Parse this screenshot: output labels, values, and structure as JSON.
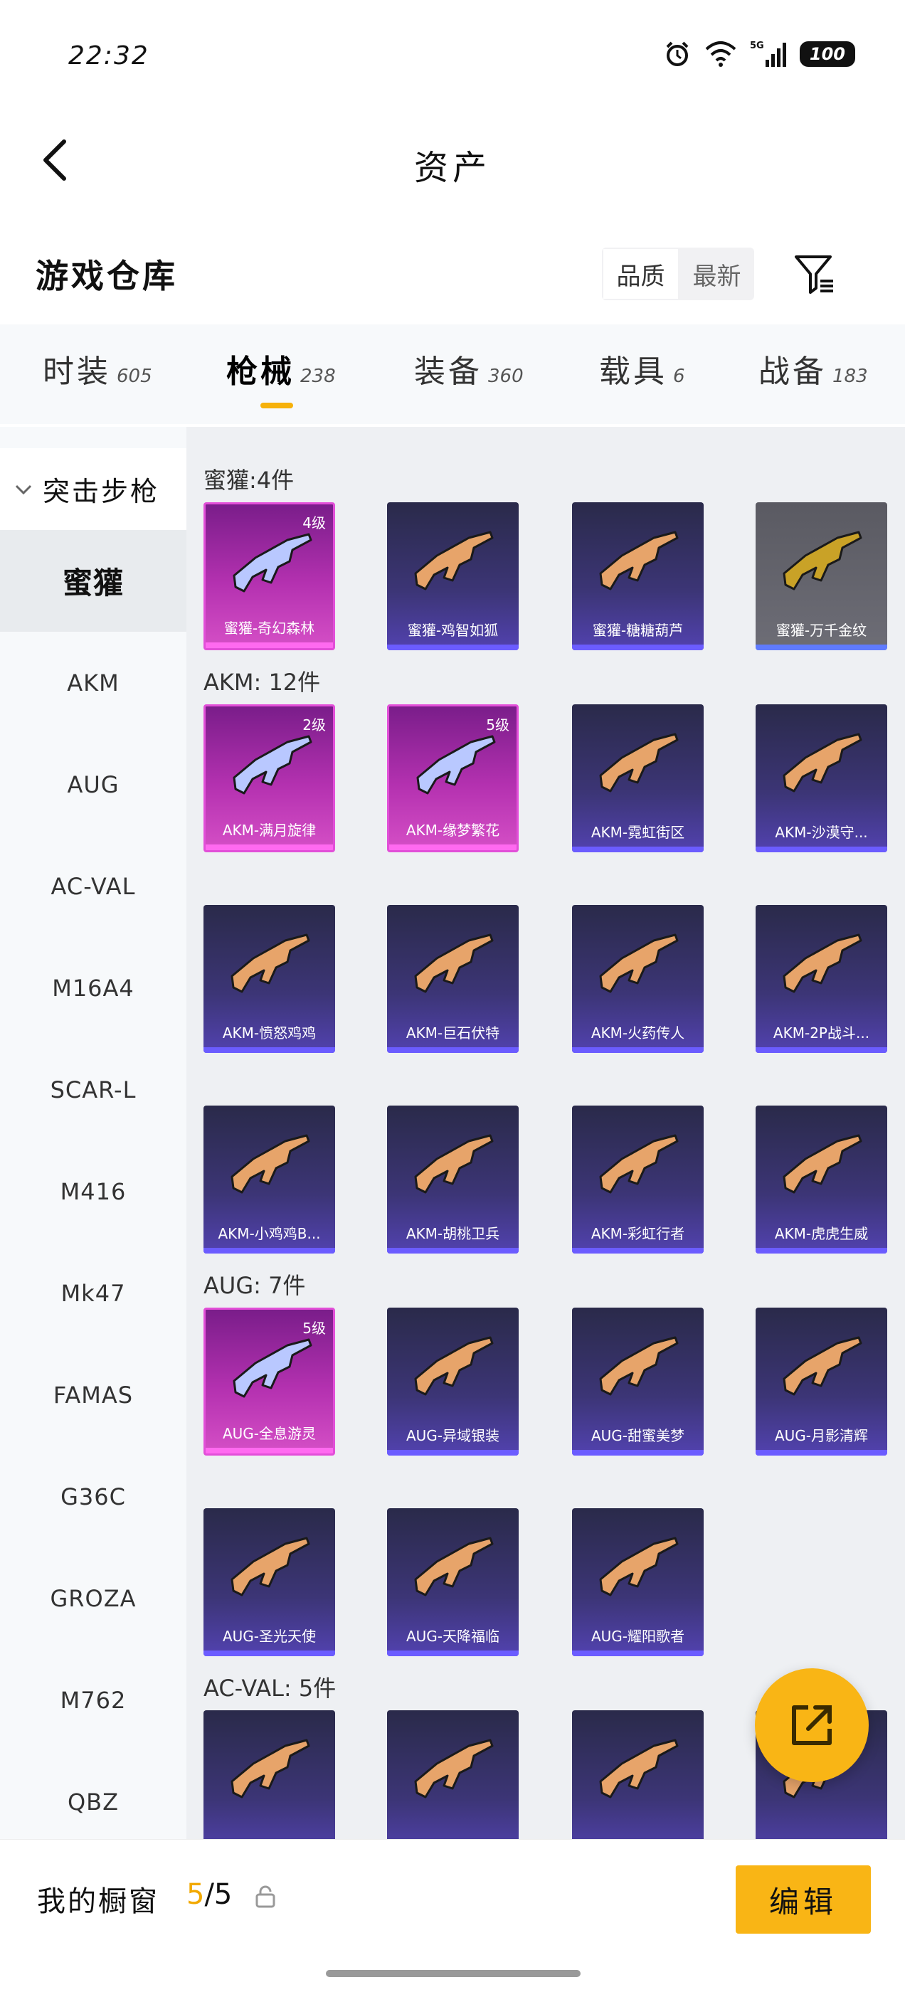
{
  "status_bar": {
    "time": "22:32",
    "battery": "100",
    "network": "5G"
  },
  "nav": {
    "title": "资产",
    "back_icon": "chevron-left-icon"
  },
  "warehouse": {
    "title": "游戏仓库",
    "sort_options": [
      "品质",
      "最新"
    ],
    "filter_icon": "filter-icon"
  },
  "tabs": [
    {
      "label": "时装",
      "count": "605"
    },
    {
      "label": "枪械",
      "count": "238"
    },
    {
      "label": "装备",
      "count": "360"
    },
    {
      "label": "载具",
      "count": "6"
    },
    {
      "label": "战备",
      "count": "183"
    }
  ],
  "sidebar": {
    "category": "突击步枪",
    "items": [
      "蜜獾",
      "AKM",
      "AUG",
      "AC-VAL",
      "M16A4",
      "SCAR-L",
      "M416",
      "Mk47",
      "FAMAS",
      "G36C",
      "GROZA",
      "M762",
      "QBZ"
    ]
  },
  "groups": [
    {
      "title": "蜜獾:4件",
      "cards": [
        {
          "label": "蜜獾-奇幻森林",
          "level": "4级",
          "rarity": "pink"
        },
        {
          "label": "蜜獾-鸡智如狐",
          "level": "",
          "rarity": "purple"
        },
        {
          "label": "蜜獾-糖糖葫芦",
          "level": "",
          "rarity": "purple"
        },
        {
          "label": "蜜獾-万千金纹",
          "level": "",
          "rarity": "gray"
        }
      ]
    },
    {
      "title": "AKM: 12件",
      "cards": [
        {
          "label": "AKM-满月旋律",
          "level": "2级",
          "rarity": "pink"
        },
        {
          "label": "AKM-缘梦繁花",
          "level": "5级",
          "rarity": "pink"
        },
        {
          "label": "AKM-霓虹街区",
          "level": "",
          "rarity": "purple"
        },
        {
          "label": "AKM-沙漠守...",
          "level": "",
          "rarity": "purple"
        },
        {
          "label": "AKM-愤怒鸡鸡",
          "level": "",
          "rarity": "purple"
        },
        {
          "label": "AKM-巨石伏特",
          "level": "",
          "rarity": "purple"
        },
        {
          "label": "AKM-火药传人",
          "level": "",
          "rarity": "purple"
        },
        {
          "label": "AKM-2P战斗...",
          "level": "",
          "rarity": "purple"
        },
        {
          "label": "AKM-小鸡鸡B...",
          "level": "",
          "rarity": "purple"
        },
        {
          "label": "AKM-胡桃卫兵",
          "level": "",
          "rarity": "purple"
        },
        {
          "label": "AKM-彩虹行者",
          "level": "",
          "rarity": "purple"
        },
        {
          "label": "AKM-虎虎生威",
          "level": "",
          "rarity": "purple"
        }
      ]
    },
    {
      "title": "AUG: 7件",
      "cards": [
        {
          "label": "AUG-全息游灵",
          "level": "5级",
          "rarity": "pink"
        },
        {
          "label": "AUG-异域银装",
          "level": "",
          "rarity": "purple"
        },
        {
          "label": "AUG-甜蜜美梦",
          "level": "",
          "rarity": "purple"
        },
        {
          "label": "AUG-月影清辉",
          "level": "",
          "rarity": "purple"
        },
        {
          "label": "AUG-圣光天使",
          "level": "",
          "rarity": "purple"
        },
        {
          "label": "AUG-天降福临",
          "level": "",
          "rarity": "purple"
        },
        {
          "label": "AUG-耀阳歌者",
          "level": "",
          "rarity": "purple"
        }
      ]
    },
    {
      "title": "AC-VAL: 5件",
      "cards": [
        {
          "label": "",
          "level": "",
          "rarity": "purple"
        },
        {
          "label": "",
          "level": "",
          "rarity": "purple"
        },
        {
          "label": "",
          "level": "",
          "rarity": "purple"
        },
        {
          "label": "",
          "level": "",
          "rarity": "purple"
        }
      ]
    }
  ],
  "fab": {
    "icon": "share-icon"
  },
  "bottom": {
    "showcase_label": "我的橱窗",
    "showcase_current": "5",
    "showcase_total": "/5",
    "edit_label": "编辑",
    "lock_icon": "lock-icon"
  },
  "colors": {
    "accent": "#f9b515",
    "tab_indicator": "#f6b10a"
  }
}
